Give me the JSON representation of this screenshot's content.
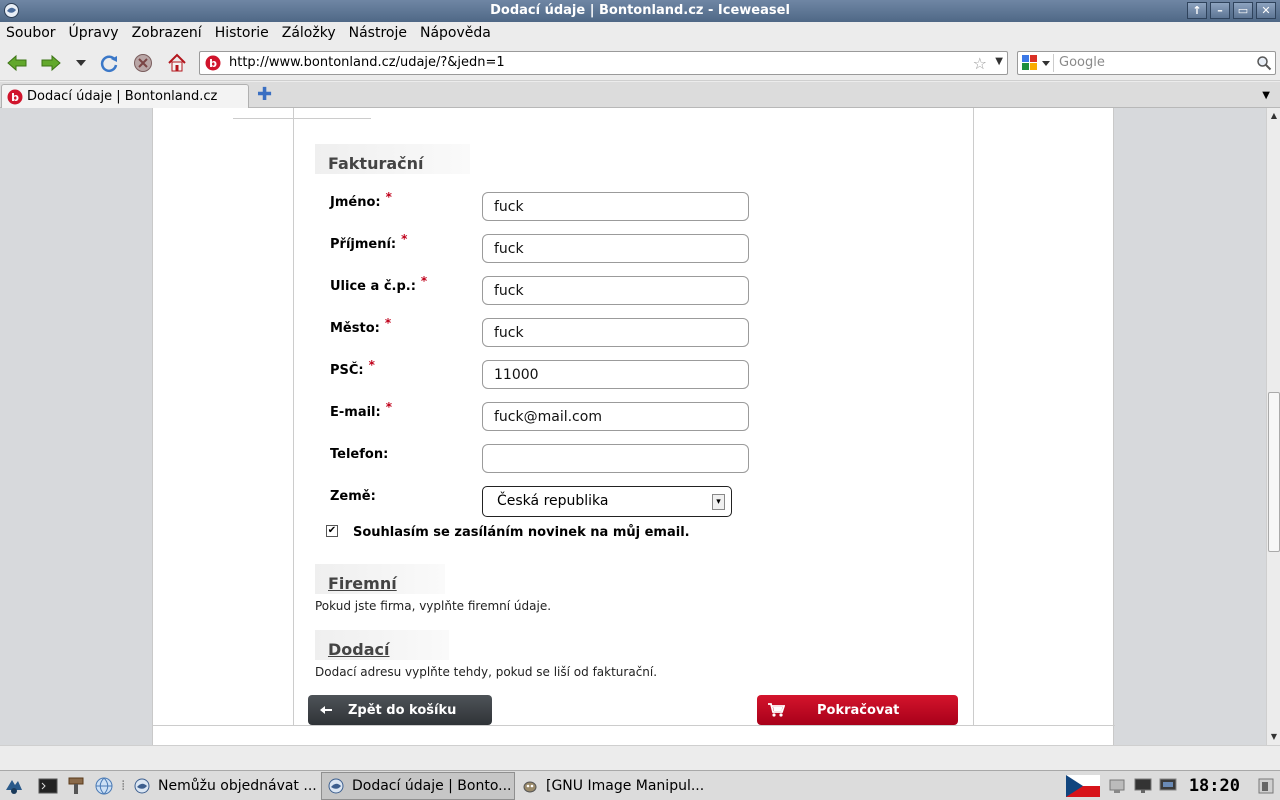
{
  "window": {
    "title": "Dodací údaje | Bontonland.cz - Iceweasel"
  },
  "menu": {
    "items": [
      "Soubor",
      "Úpravy",
      "Zobrazení",
      "Historie",
      "Záložky",
      "Nástroje",
      "Nápověda"
    ]
  },
  "navigation": {
    "url": "http://www.bontonland.cz/udaje/?&jedn=1",
    "search_placeholder": "Google"
  },
  "tabs": {
    "active_title": "Dodací údaje | Bontonland.cz"
  },
  "billing": {
    "heading": "Fakturační údaje",
    "required_mark": "*",
    "fields": [
      {
        "label": "Jméno:",
        "value": "fuck",
        "required": true
      },
      {
        "label": "Příjmení:",
        "value": "fuck",
        "required": true
      },
      {
        "label": "Ulice a č.p.:",
        "value": "fuck",
        "required": true
      },
      {
        "label": "Město:",
        "value": "fuck",
        "required": true
      },
      {
        "label": "PSČ:",
        "value": "11000",
        "required": true
      },
      {
        "label": "E-mail:",
        "value": "fuck@mail.com",
        "required": true
      },
      {
        "label": "Telefon:",
        "value": "",
        "required": false
      }
    ],
    "country_label": "Země:",
    "country_value": "Česká republika",
    "newsletter_label": "Souhlasím se zasíláním novinek na můj email.",
    "newsletter_checked": true
  },
  "company": {
    "heading": "Firemní údaje",
    "note": "Pokud jste firma, vyplňte firemní údaje."
  },
  "delivery": {
    "heading": "Dodací adresa",
    "note": "Dodací adresu vyplňte tehdy, pokud se liší od fakturační."
  },
  "actions": {
    "back_label": "Zpět do košíku",
    "continue_label": "Pokračovat"
  },
  "taskbar": {
    "tasks": [
      "Nemůžu objednávat ...",
      "Dodací údaje | Bonto...",
      "[GNU Image Manipul..."
    ],
    "clock": "18:20"
  },
  "colors": {
    "accent_red": "#c0001a",
    "back_button": "#3a3e42",
    "page_background": "#d7d9dc"
  }
}
